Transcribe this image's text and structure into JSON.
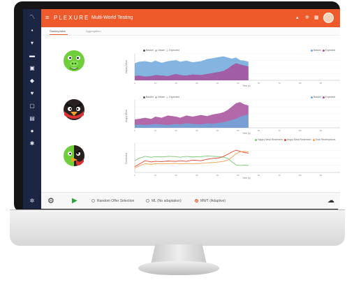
{
  "header": {
    "brand": "PLEXURE",
    "title": "Multi-World Testing",
    "menu_icon": "hamburger-icon",
    "right_icons": [
      "bell-icon",
      "gear-icon",
      "grid-icon"
    ]
  },
  "tabs": [
    {
      "label": "Sankey/ation",
      "active": true
    },
    {
      "label": "Aggregation",
      "active": false
    }
  ],
  "sidebar": {
    "icons": [
      "logo-icon",
      "dashboard-icon",
      "tag-icon",
      "user-icon",
      "chat-icon",
      "label-icon",
      "heart-icon",
      "copy-icon",
      "layers-icon",
      "pin-icon",
      "settings-icon"
    ],
    "bottom_icon": "gear-icon"
  },
  "rows": [
    {
      "bird": "green-pig",
      "ylabel": "Happy Meal",
      "legend_left": [
        "Basket",
        "Viewer",
        "Expected"
      ],
      "legend_right": [
        "Basket",
        "Expected"
      ],
      "xlabel": "Time (s)",
      "xticks": [
        "0",
        "10",
        "20",
        "30",
        "40",
        "50",
        "60",
        "70",
        "80",
        "90",
        "100"
      ]
    },
    {
      "bird": "red-angry-bird",
      "ylabel": "Angry Meal",
      "legend_left": [
        "Basket",
        "Viewer",
        "Expected"
      ],
      "legend_right": [
        "Basket",
        "Expected"
      ],
      "xlabel": "Time (s)",
      "xticks": [
        "0",
        "10",
        "20",
        "30",
        "40",
        "50",
        "60",
        "70",
        "80",
        "90",
        "100"
      ]
    },
    {
      "bird": "combined",
      "ylabel": "Combined",
      "legend_right": [
        "Happy Meal Redemetn",
        "Angry Meal Redemetn",
        "Total Redemptions"
      ],
      "xlabel": "Time (s)",
      "xticks": [
        "0",
        "10",
        "20",
        "30",
        "40",
        "50",
        "60",
        "70",
        "80",
        "90",
        "100"
      ]
    }
  ],
  "chart_data": [
    {
      "type": "area",
      "x": [
        0,
        2,
        5,
        8,
        10,
        13,
        16,
        20,
        22,
        25,
        28,
        32,
        35,
        38,
        41,
        43,
        45,
        47,
        49,
        51,
        53,
        55
      ],
      "series": [
        {
          "name": "Basket",
          "color": "#6fa8dc",
          "values": [
            32,
            35,
            36,
            34,
            37,
            33,
            36,
            38,
            35,
            37,
            34,
            36,
            40,
            42,
            44,
            45,
            43,
            41,
            43,
            38,
            37,
            35
          ]
        },
        {
          "name": "Expected",
          "color": "#a64d9b",
          "values": [
            8,
            9,
            7,
            8,
            10,
            9,
            8,
            12,
            10,
            9,
            11,
            10,
            12,
            14,
            16,
            18,
            22,
            28,
            32,
            30,
            28,
            26
          ]
        }
      ],
      "ylim": [
        0,
        50
      ],
      "xlim": [
        0,
        100
      ]
    },
    {
      "type": "area",
      "x": [
        0,
        2,
        5,
        8,
        10,
        13,
        16,
        20,
        22,
        25,
        28,
        32,
        35,
        38,
        41,
        43,
        45,
        47,
        49,
        51,
        53,
        55
      ],
      "series": [
        {
          "name": "Expected",
          "color": "#a64d9b",
          "values": [
            15,
            16,
            18,
            16,
            20,
            18,
            22,
            20,
            18,
            22,
            20,
            23,
            21,
            24,
            26,
            28,
            32,
            38,
            44,
            46,
            42,
            40
          ]
        },
        {
          "name": "Basket",
          "color": "#6fa8dc",
          "values": [
            5,
            6,
            5,
            6,
            7,
            6,
            5,
            7,
            6,
            8,
            7,
            6,
            8,
            7,
            9,
            10,
            12,
            14,
            16,
            20,
            22,
            24
          ]
        }
      ],
      "ylim": [
        0,
        50
      ],
      "xlim": [
        0,
        100
      ]
    },
    {
      "type": "line",
      "x": [
        0,
        2,
        5,
        8,
        10,
        13,
        16,
        20,
        22,
        25,
        28,
        32,
        35,
        38,
        41,
        43,
        45,
        47,
        49,
        51,
        53,
        55
      ],
      "series": [
        {
          "name": "Happy Meal Redemetn",
          "color": "#7cc576",
          "values": [
            40,
            48,
            55,
            52,
            54,
            53,
            55,
            54,
            52,
            55,
            53,
            54,
            56,
            55,
            54,
            52,
            48,
            36,
            26,
            24,
            25,
            24
          ]
        },
        {
          "name": "Angry Meal Redemetn",
          "color": "#e0442e",
          "values": [
            20,
            28,
            40,
            36,
            38,
            37,
            39,
            38,
            40,
            38,
            42,
            40,
            45,
            48,
            50,
            55,
            62,
            70,
            76,
            72,
            68,
            66
          ]
        },
        {
          "name": "Total Redemptions",
          "color": "#f5a04a",
          "values": [
            15,
            22,
            30,
            28,
            30,
            29,
            30,
            31,
            29,
            31,
            30,
            31,
            33,
            34,
            36,
            38,
            42,
            52,
            64,
            70,
            72,
            70
          ]
        }
      ],
      "ylim": [
        0,
        100
      ],
      "xlim": [
        0,
        100
      ]
    }
  ],
  "footer": {
    "options": [
      {
        "label": "Random Offer Selection",
        "selected": false
      },
      {
        "label": "ML (No adaptation)",
        "selected": false
      },
      {
        "label": "MWT (Adaptive)",
        "selected": true
      }
    ],
    "icons": [
      "gear-icon",
      "play-icon",
      "cloud-icon",
      "sun-icon"
    ]
  }
}
